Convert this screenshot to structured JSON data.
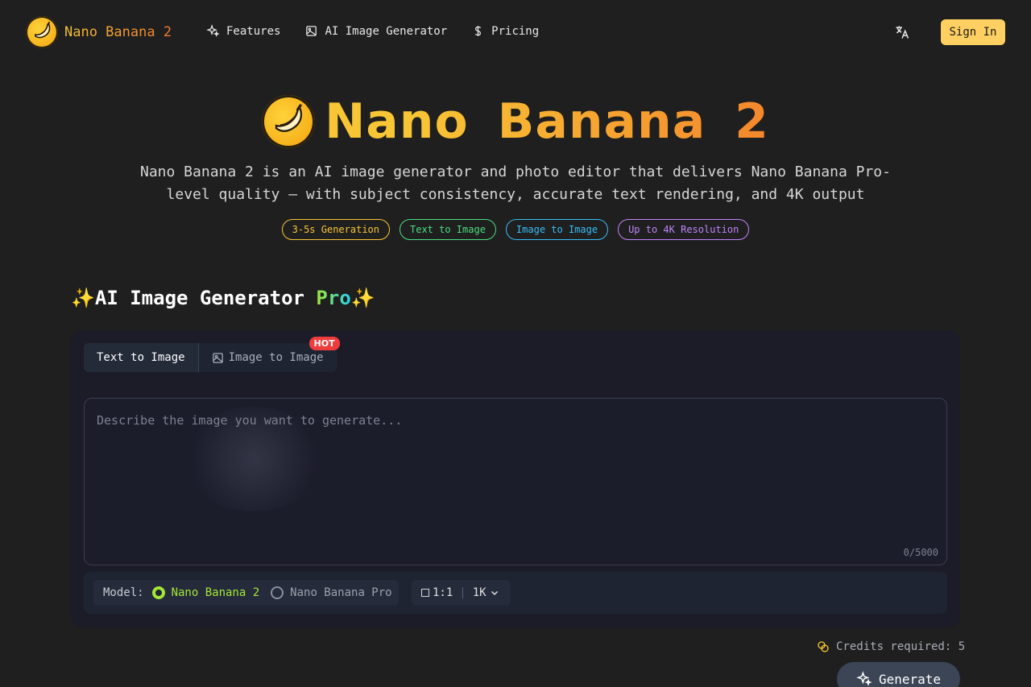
{
  "nav": {
    "brand": "Nano Banana 2",
    "links": [
      {
        "label": "Features",
        "icon": "sparkles-icon"
      },
      {
        "label": "AI Image Generator",
        "icon": "image-icon"
      },
      {
        "label": "Pricing",
        "icon": "dollar-icon"
      }
    ],
    "sign_in": "Sign In"
  },
  "hero": {
    "title": "Nano Banana 2",
    "subtitle": "Nano Banana 2 is an AI image generator and photo editor that delivers Nano Banana Pro-level quality — with subject consistency, accurate text rendering, and 4K output",
    "badges": [
      {
        "label": "3-5s Generation",
        "color": "#f8c534"
      },
      {
        "label": "Text to Image",
        "color": "#4ade80"
      },
      {
        "label": "Image to Image",
        "color": "#38bdf8"
      },
      {
        "label": "Up to 4K Resolution",
        "color": "#c084fc"
      }
    ]
  },
  "generator": {
    "title_prefix": "✨AI Image Generator ",
    "title_pro": "Pro",
    "title_suffix": "✨",
    "tabs": [
      {
        "label": "Text to Image",
        "active": true
      },
      {
        "label": "Image to Image",
        "active": false,
        "badge": "HOT"
      }
    ],
    "prompt_placeholder": "Describe the image you want to generate...",
    "prompt_value": "",
    "counter": "0/5000",
    "model_label": "Model:",
    "models": [
      {
        "label": "Nano Banana 2",
        "selected": true
      },
      {
        "label": "Nano Banana Pro",
        "selected": false
      }
    ],
    "aspect_ratio": "1:1",
    "resolution": "1K",
    "credits_label": "Credits required: 5",
    "generate_label": "Generate"
  },
  "colors": {
    "accent": "#ffd061",
    "pro_green": "#a3e635",
    "hot_red": "#ef3b3b"
  }
}
